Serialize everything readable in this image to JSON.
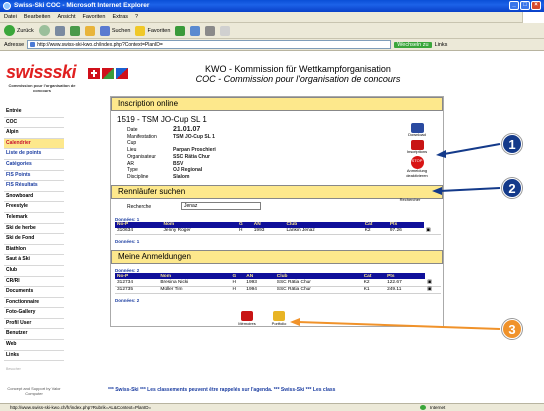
{
  "window": {
    "title": "Swiss-Ski COC - Microsoft Internet Explorer",
    "controls": [
      "_",
      "□",
      "×"
    ]
  },
  "menu": [
    "Datei",
    "Bearbeiten",
    "Ansicht",
    "Favoriten",
    "Extras",
    "?"
  ],
  "toolbar": {
    "back": "Zurück",
    "search": "Suchen",
    "favorites": "Favoriten"
  },
  "address": {
    "label": "Adresse",
    "url": "http://www.swiss-ski-kwo.ch/index.php?Context=PlanID=",
    "go": "Wechseln zu",
    "links": "Links"
  },
  "logo": {
    "name": "swissski",
    "subtitle": "Commission pour l'organisation de concours"
  },
  "header": {
    "line1": "KWO - Kommission für Wettkampforganisation",
    "line2": "COC - Commission pour l'organisation de concours"
  },
  "sidebar": {
    "items": [
      {
        "label": "Entrée",
        "style": "black"
      },
      {
        "label": "COC",
        "style": "black"
      },
      {
        "label": "Alpin",
        "style": "black"
      },
      {
        "label": "Calendrier",
        "style": "sel"
      },
      {
        "label": "Liste de points",
        "style": "blue"
      },
      {
        "label": "Catégories",
        "style": "blue"
      },
      {
        "label": "FIS Points",
        "style": "blue"
      },
      {
        "label": "FIS Résultats",
        "style": "blue"
      },
      {
        "label": "Snowboard",
        "style": "black"
      },
      {
        "label": "Freestyle",
        "style": "black"
      },
      {
        "label": "Telemark",
        "style": "black"
      },
      {
        "label": "Ski de herbe",
        "style": "black"
      },
      {
        "label": "Ski de Fond",
        "style": "black"
      },
      {
        "label": "Biathlon",
        "style": "black"
      },
      {
        "label": "Saut à Ski",
        "style": "black"
      },
      {
        "label": "Club",
        "style": "black"
      },
      {
        "label": "CR/RI",
        "style": "black"
      },
      {
        "label": "Documents",
        "style": "black"
      },
      {
        "label": "Fonctionnaire",
        "style": "black"
      },
      {
        "label": "Foto-Gallery",
        "style": "black"
      },
      {
        "label": "Profil User",
        "style": "black"
      },
      {
        "label": "Benutzer",
        "style": "black"
      },
      {
        "label": "Web",
        "style": "black"
      },
      {
        "label": "Links",
        "style": "black"
      }
    ],
    "mini": "Besucher",
    "sponsor": "Concept and Support by Valor Computer"
  },
  "main": {
    "section1_title": "Inscription online",
    "event_title": "1519 - TSM JO-Cup SL 1",
    "details": [
      {
        "label": "Date",
        "value": "21.01.07",
        "big": true
      },
      {
        "label": "Manifestation",
        "value": "TSM JO-Cup SL 1"
      },
      {
        "label": "Cup",
        "value": ""
      },
      {
        "label": "Lieu",
        "value": "Parpan Proschieri"
      },
      {
        "label": "Organisateur",
        "value": "SSC Rätia Chur"
      },
      {
        "label": "AR",
        "value": "BSV"
      },
      {
        "label": "Type",
        "value": "OJ Regional"
      },
      {
        "label": "Discipline",
        "value": "Slalom"
      }
    ],
    "side_icons": {
      "download": "Download",
      "inscriptions": "Inscriptions",
      "deactivate": "Anmeldung deaktivieren",
      "stop": "STOP"
    },
    "search_title": "Rennläufer suchen",
    "search_label": "Recherche",
    "search_value": "Jenaz",
    "search_button": "Rechercher",
    "results_count": "Données: 1",
    "table_headers": [
      "No-P",
      "Nom",
      "G",
      "AN",
      "Club",
      "Cat",
      "Pts"
    ],
    "results": [
      {
        "nop": "310634",
        "nom": "Jenny Roger",
        "g": "H",
        "an": "1993",
        "club": "Lankin Jenaz",
        "cat": "K2",
        "pts": "97.26"
      }
    ],
    "results_footer": "Données: 1",
    "meine_title": "Meine Anmeldungen",
    "meine_count": "Données: 2",
    "meine": [
      {
        "nop": "312734",
        "nom": "Bresina Nicki",
        "g": "H",
        "an": "1993",
        "club": "SSC Rätia Chur",
        "cat": "K2",
        "pts": "122.67"
      },
      {
        "nop": "312735",
        "nom": "Müller Tim",
        "g": "H",
        "an": "1994",
        "club": "SSC Rätia Chur",
        "cat": "K1",
        "pts": "249.11"
      }
    ],
    "meine_footer": "Données: 2",
    "bottom_icons": [
      "Mémoires",
      "Portfolio"
    ]
  },
  "ticker": "*** Swiss-Ski ***   Les classements peuvent être rappelés sur l'agenda.   *** Swiss-Ski ***   Les class",
  "status": {
    "url": "http://www.swiss-ski-kwo.ch/fr/index.php?Rubrik=AL&Context=PlanID=",
    "zone": "Internet"
  },
  "callouts": [
    "1",
    "2",
    "3"
  ]
}
